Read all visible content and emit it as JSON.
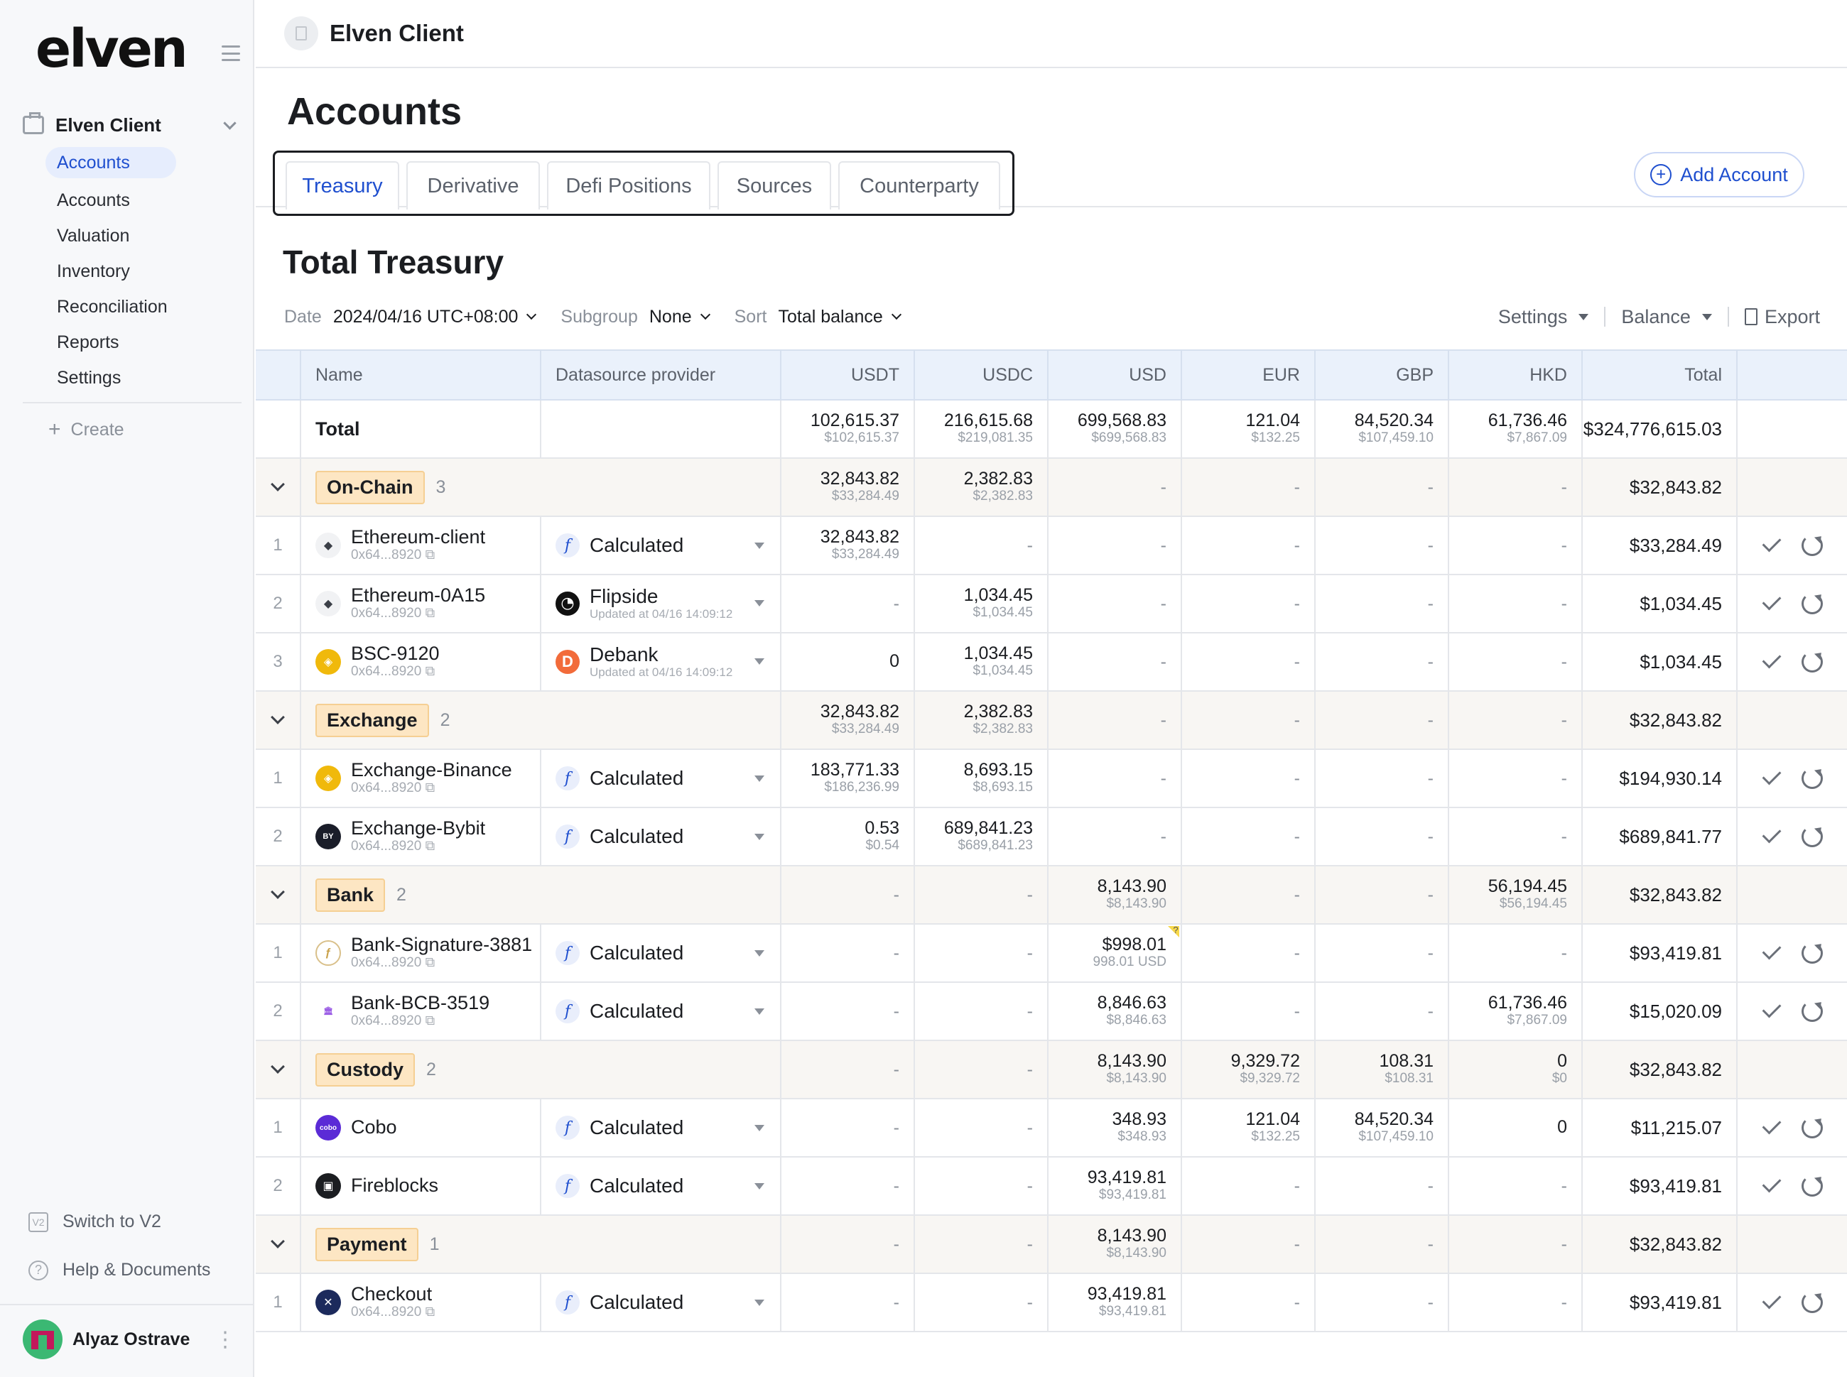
{
  "sidebar": {
    "logo": "elven",
    "org": "Elven Client",
    "nav": [
      "Accounts",
      "Accounts",
      "Valuation",
      "Inventory",
      "Reconciliation",
      "Reports",
      "Settings"
    ],
    "create": "Create",
    "switch": "Switch to V2",
    "switch_icon": "V2",
    "help": "Help & Documents",
    "help_icon": "?",
    "user": "Alyaz Ostrave"
  },
  "topbar": {
    "title": "Elven Client"
  },
  "page": {
    "title": "Accounts",
    "tabs": [
      "Treasury",
      "Derivative",
      "Defi Positions",
      "Sources",
      "Counterparty"
    ],
    "add_button": "Add Account",
    "section_title": "Total Treasury"
  },
  "filters": {
    "date_label": "Date",
    "date_value": "2024/04/16 UTC+08:00",
    "subgroup_label": "Subgroup",
    "subgroup_value": "None",
    "sort_label": "Sort",
    "sort_value": "Total balance",
    "settings": "Settings",
    "balance": "Balance",
    "export": "Export"
  },
  "table": {
    "headers": [
      "Name",
      "Datasource provider",
      "USDT",
      "USDC",
      "USD",
      "EUR",
      "GBP",
      "HKD",
      "Total"
    ],
    "total": {
      "label": "Total",
      "cells": [
        [
          "102,615.37",
          "$102,615.37"
        ],
        [
          "216,615.68",
          "$219,081.35"
        ],
        [
          "699,568.83",
          "$699,568.83"
        ],
        [
          "121.04",
          "$132.25"
        ],
        [
          "84,520.34",
          "$107,459.10"
        ],
        [
          "61,736.46",
          "$7,867.09"
        ]
      ],
      "total": "$324,776,615.03"
    },
    "rows": [
      {
        "type": "group",
        "name": "On-Chain",
        "count": "3",
        "cells": [
          [
            "32,843.82",
            "$33,284.49"
          ],
          [
            "2,382.83",
            "$2,382.83"
          ],
          "-",
          "-",
          "-",
          "-"
        ],
        "total": "$32,843.82"
      },
      {
        "type": "item",
        "idx": "1",
        "name": "Ethereum-client",
        "addr": "0x64...8920",
        "icon": "eth",
        "provider": "Calculated",
        "pkind": "calc",
        "updated": "",
        "cells": [
          [
            "32,843.82",
            "$33,284.49"
          ],
          "-",
          "-",
          "-",
          "-",
          "-"
        ],
        "total": "$33,284.49"
      },
      {
        "type": "item",
        "idx": "2",
        "name": "Ethereum-0A15",
        "addr": "0x64...8920",
        "icon": "eth",
        "provider": "Flipside",
        "pkind": "flip",
        "updated": "Updated at 04/16 14:09:12",
        "cells": [
          "-",
          [
            "1,034.45",
            "$1,034.45"
          ],
          "-",
          "-",
          "-",
          "-"
        ],
        "total": "$1,034.45"
      },
      {
        "type": "item",
        "idx": "3",
        "name": "BSC-9120",
        "addr": "0x64...8920",
        "icon": "bsc",
        "provider": "Debank",
        "pkind": "deb",
        "updated": "Updated at 04/16 14:09:12",
        "cells": [
          [
            "0",
            ""
          ],
          [
            "1,034.45",
            "$1,034.45"
          ],
          "-",
          "-",
          "-",
          "-"
        ],
        "total": "$1,034.45"
      },
      {
        "type": "group",
        "name": "Exchange",
        "count": "2",
        "cells": [
          [
            "32,843.82",
            "$33,284.49"
          ],
          [
            "2,382.83",
            "$2,382.83"
          ],
          "-",
          "-",
          "-",
          "-"
        ],
        "total": "$32,843.82"
      },
      {
        "type": "item",
        "idx": "1",
        "name": "Exchange-Binance",
        "addr": "0x64...8920",
        "icon": "bsc",
        "provider": "Calculated",
        "pkind": "calc",
        "updated": "",
        "cells": [
          [
            "183,771.33",
            "$186,236.99"
          ],
          [
            "8,693.15",
            "$8,693.15"
          ],
          "-",
          "-",
          "-",
          "-"
        ],
        "total": "$194,930.14"
      },
      {
        "type": "item",
        "idx": "2",
        "name": "Exchange-Bybit",
        "addr": "0x64...8920",
        "icon": "bybit",
        "provider": "Calculated",
        "pkind": "calc",
        "updated": "",
        "cells": [
          [
            "0.53",
            "$0.54"
          ],
          [
            "689,841.23",
            "$689,841.23"
          ],
          "-",
          "-",
          "-",
          "-"
        ],
        "total": "$689,841.77"
      },
      {
        "type": "group",
        "name": "Bank",
        "count": "2",
        "cells": [
          "-",
          "-",
          [
            "8,143.90",
            "$8,143.90"
          ],
          "-",
          "-",
          [
            "56,194.45",
            "$56,194.45"
          ]
        ],
        "total": "$32,843.82"
      },
      {
        "type": "item",
        "idx": "1",
        "name": "Bank-Signature-3881",
        "addr": "0x64...8920",
        "icon": "sig",
        "provider": "Calculated",
        "pkind": "calc",
        "updated": "",
        "cells": [
          "-",
          "-",
          [
            "$998.01",
            "998.01 USD"
          ],
          "-",
          "-",
          "-"
        ],
        "flag": true,
        "total": "$93,419.81"
      },
      {
        "type": "item",
        "idx": "2",
        "name": "Bank-BCB-3519",
        "addr": "0x64...8920",
        "icon": "bank",
        "provider": "Calculated",
        "pkind": "calc",
        "updated": "",
        "cells": [
          "-",
          "-",
          [
            "8,846.63",
            "$8,846.63"
          ],
          "-",
          "-",
          [
            "61,736.46",
            "$7,867.09"
          ]
        ],
        "total": "$15,020.09"
      },
      {
        "type": "group",
        "name": "Custody",
        "count": "2",
        "cells": [
          "-",
          "-",
          [
            "8,143.90",
            "$8,143.90"
          ],
          [
            "9,329.72",
            "$9,329.72"
          ],
          [
            "108.31",
            "$108.31"
          ],
          [
            "0",
            "$0"
          ]
        ],
        "total": "$32,843.82"
      },
      {
        "type": "item",
        "idx": "1",
        "name": "Cobo",
        "addr": "",
        "icon": "cobo",
        "provider": "Calculated",
        "pkind": "calc",
        "updated": "",
        "cells": [
          "-",
          "-",
          [
            "348.93",
            "$348.93"
          ],
          [
            "121.04",
            "$132.25"
          ],
          [
            "84,520.34",
            "$107,459.10"
          ],
          [
            "0",
            ""
          ]
        ],
        "total": "$11,215.07"
      },
      {
        "type": "item",
        "idx": "2",
        "name": "Fireblocks",
        "addr": "",
        "icon": "fire",
        "provider": "Calculated",
        "pkind": "calc",
        "updated": "",
        "cells": [
          "-",
          "-",
          [
            "93,419.81",
            "$93,419.81"
          ],
          "-",
          "-",
          "-"
        ],
        "total": "$93,419.81"
      },
      {
        "type": "group",
        "name": "Payment",
        "count": "1",
        "cells": [
          "-",
          "-",
          [
            "8,143.90",
            "$8,143.90"
          ],
          "-",
          "-",
          "-"
        ],
        "total": "$32,843.82"
      },
      {
        "type": "item",
        "idx": "1",
        "name": "Checkout",
        "addr": "0x64...8920",
        "icon": "checkout",
        "provider": "Calculated",
        "pkind": "calc",
        "updated": "",
        "cells": [
          "-",
          "-",
          [
            "93,419.81",
            "$93,419.81"
          ],
          "-",
          "-",
          "-"
        ],
        "total": "$93,419.81"
      }
    ]
  },
  "colors": {
    "accent": "#1f4fcf",
    "group_tag": "#fde6c3",
    "header_bg": "#eaf1fb"
  }
}
